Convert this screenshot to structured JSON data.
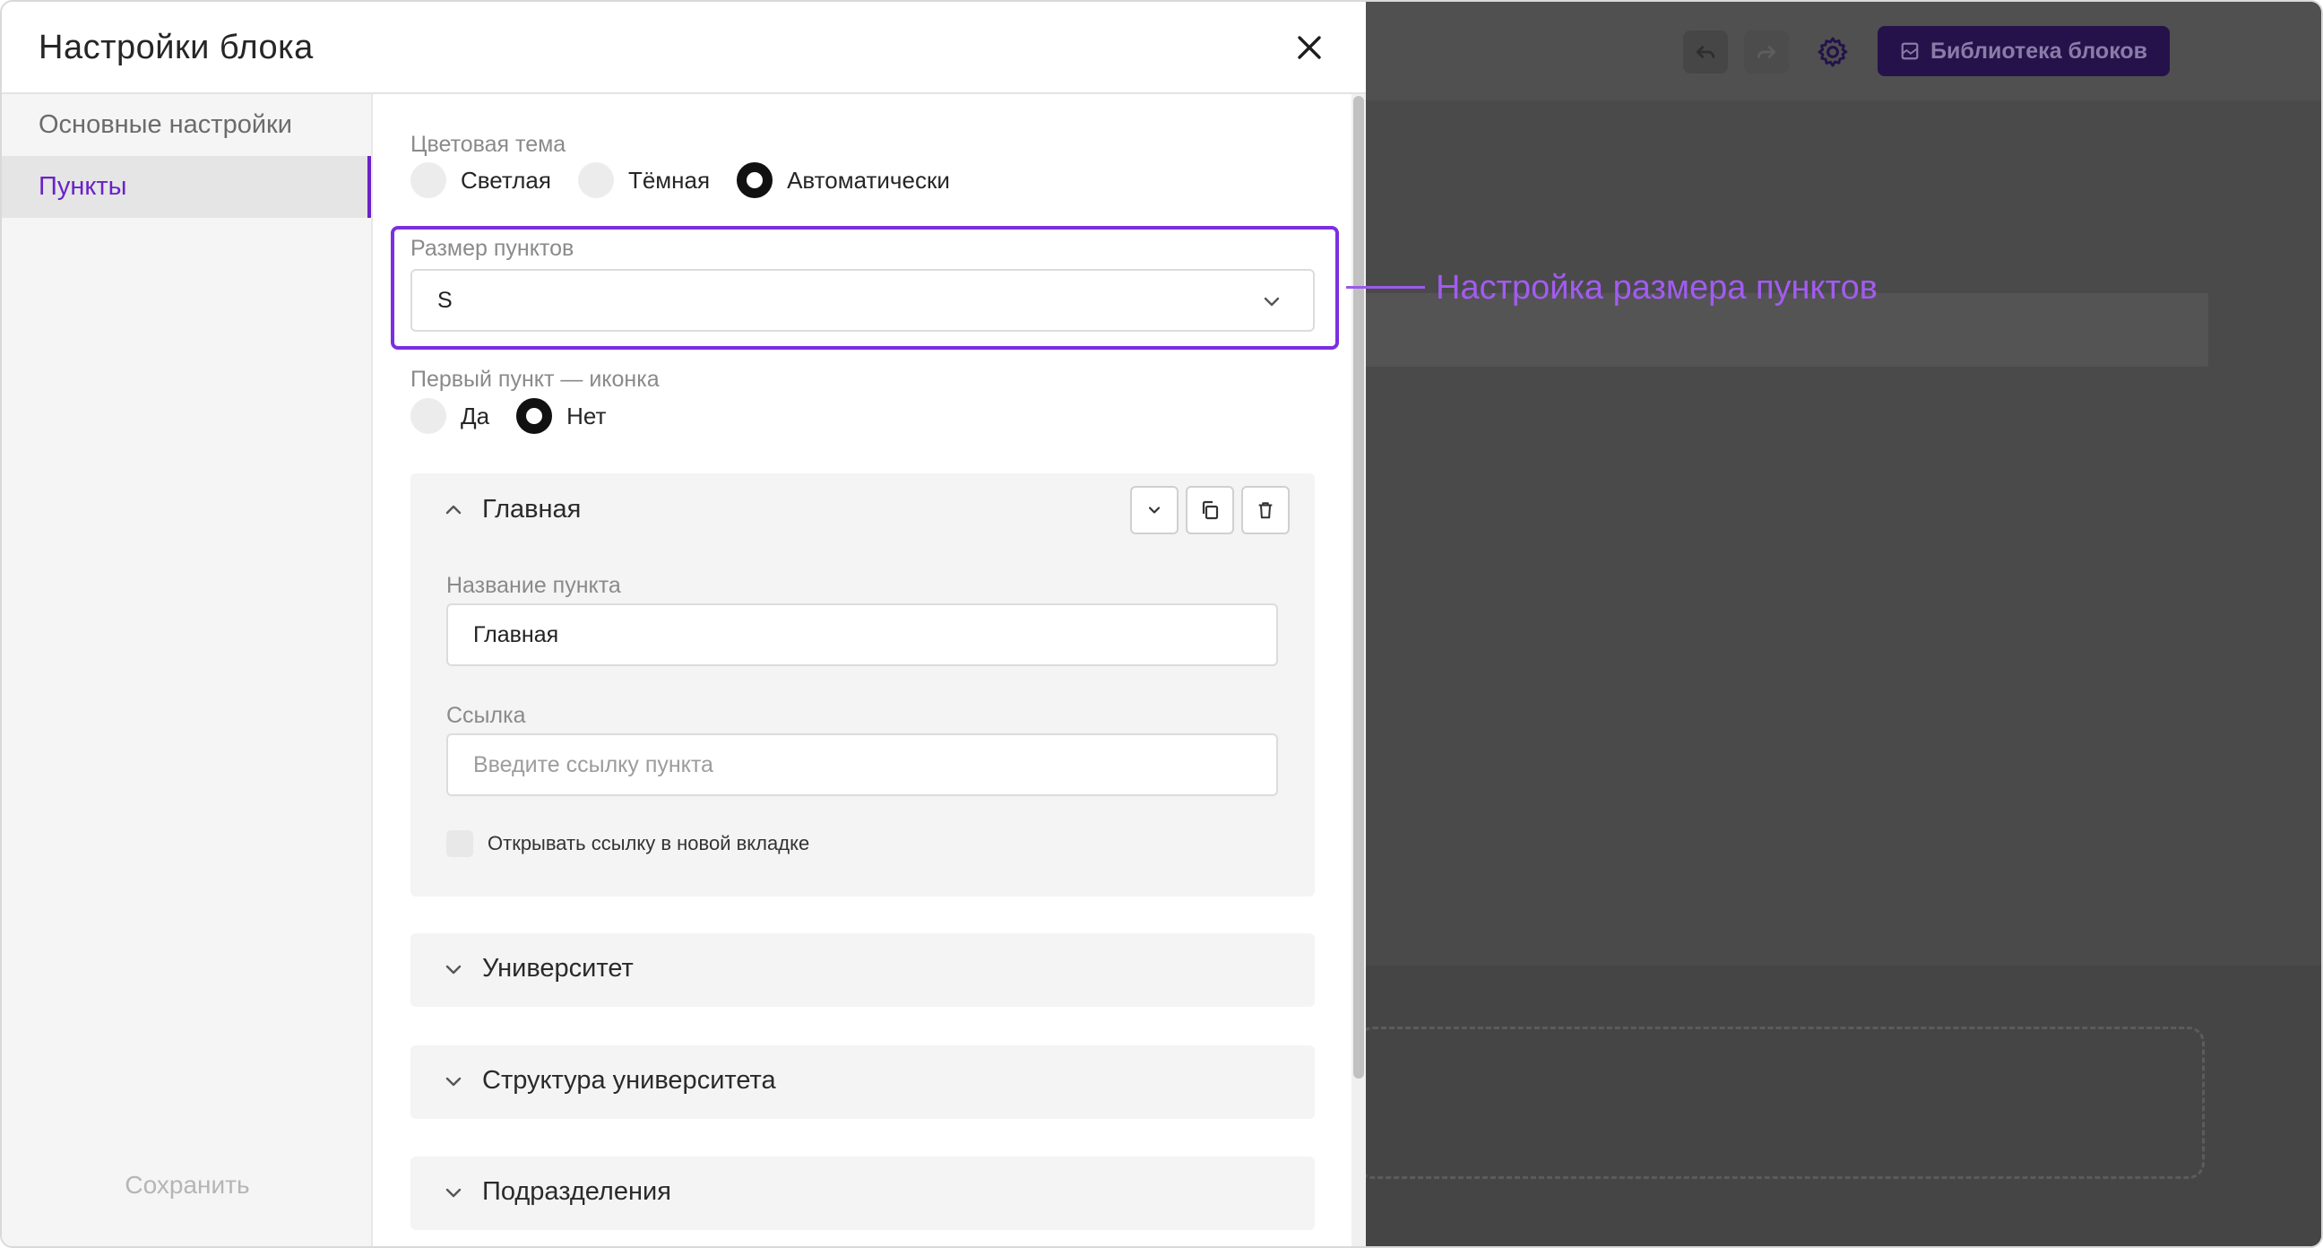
{
  "modal": {
    "title": "Настройки блока",
    "close_icon": "close-icon",
    "save_label": "Сохранить"
  },
  "sidebar": {
    "items": [
      {
        "label": "Основные настройки",
        "active": false
      },
      {
        "label": "Пункты",
        "active": true
      }
    ]
  },
  "color_theme": {
    "label": "Цветовая тема",
    "options": [
      {
        "label": "Светлая",
        "selected": false
      },
      {
        "label": "Тёмная",
        "selected": false
      },
      {
        "label": "Автоматически",
        "selected": true
      }
    ]
  },
  "item_size": {
    "label": "Размер пунктов",
    "value": "S",
    "icon": "chevron-down-icon"
  },
  "first_item_icon": {
    "label": "Первый пункт — иконка",
    "options": [
      {
        "label": "Да",
        "selected": false
      },
      {
        "label": "Нет",
        "selected": true
      }
    ]
  },
  "menu_items": [
    {
      "title": "Главная",
      "expanded": true,
      "name_label": "Название пункта",
      "name_value": "Главная",
      "link_label": "Ссылка",
      "link_placeholder": "Введите ссылку пункта",
      "new_tab_label": "Открывать ссылку в новой вкладке",
      "new_tab_checked": false
    },
    {
      "title": "Университет",
      "expanded": false
    },
    {
      "title": "Структура университета",
      "expanded": false
    },
    {
      "title": "Подразделения",
      "expanded": false
    }
  ],
  "annotation": {
    "text": "Настройка размера пунктов",
    "color": "#a15cf0"
  },
  "editor_toolbar": {
    "library_label": "Библиотека блоков",
    "icons": [
      "undo-icon",
      "redo-icon",
      "gear-icon",
      "library-icon"
    ]
  },
  "colors": {
    "accent": "#6a22c9",
    "highlight_border": "#7b2fe0",
    "library_button": "#25124a"
  }
}
